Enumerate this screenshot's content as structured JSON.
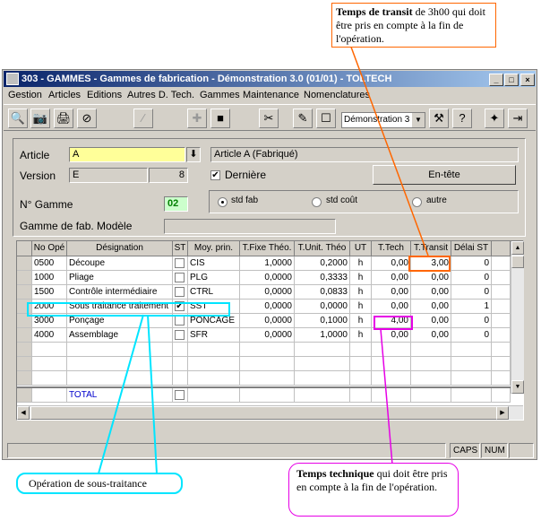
{
  "window": {
    "title": "303 - GAMMES - Gammes de fabrication - Démonstration 3.0 (01/01) - TOLTECH",
    "min": "_",
    "max": "□",
    "close": "×"
  },
  "menu": [
    "Gestion",
    "Articles",
    "Editions",
    "Autres D. Tech.",
    "Gammes",
    "Maintenance",
    "Nomenclatures"
  ],
  "toolbar": {
    "combo_value": "Démonstration 3"
  },
  "form": {
    "article_label": "Article",
    "article_value": "A",
    "article_desc": "Article A (Fabriqué)",
    "version_label": "Version",
    "version_value": "E",
    "version_num": "8",
    "derniere_label": "Dernière",
    "entete_label": "En-tête",
    "gamme_label": "N° Gamme",
    "gamme_value": "02",
    "radio_std_fab": "std fab",
    "radio_std_cout": "std coût",
    "radio_autre": "autre",
    "modele_label": "Gamme de fab. Modèle"
  },
  "columns": [
    "No Opé",
    "Désignation",
    "ST",
    "Moy. prin.",
    "T.Fixe Théo.",
    "T.Unit. Théo",
    "UT",
    "T.Tech",
    "T.Transit",
    "Délai ST"
  ],
  "rows": [
    {
      "no": "0500",
      "des": "Découpe",
      "st": "",
      "moy": "CIS",
      "tfixe": "1,0000",
      "tunit": "0,2000",
      "ut": "h",
      "ttech": "0,00",
      "ttransit": "3,00",
      "delai": "0"
    },
    {
      "no": "1000",
      "des": "Pliage",
      "st": "",
      "moy": "PLG",
      "tfixe": "0,0000",
      "tunit": "0,3333",
      "ut": "h",
      "ttech": "0,00",
      "ttransit": "0,00",
      "delai": "0"
    },
    {
      "no": "1500",
      "des": "Contrôle intermédiaire",
      "st": "",
      "moy": "CTRL",
      "tfixe": "0,0000",
      "tunit": "0,0833",
      "ut": "h",
      "ttech": "0,00",
      "ttransit": "0,00",
      "delai": "0"
    },
    {
      "no": "2000",
      "des": "Sous traitance traitement",
      "st": "✔",
      "moy": "SST",
      "tfixe": "0,0000",
      "tunit": "0,0000",
      "ut": "h",
      "ttech": "0,00",
      "ttransit": "0,00",
      "delai": "1"
    },
    {
      "no": "3000",
      "des": "Ponçage",
      "st": "",
      "moy": "PONCAGE",
      "tfixe": "0,0000",
      "tunit": "0,1000",
      "ut": "h",
      "ttech": "4,00",
      "ttransit": "0,00",
      "delai": "0"
    },
    {
      "no": "4000",
      "des": "Assemblage",
      "st": "",
      "moy": "SFR",
      "tfixe": "0,0000",
      "tunit": "1,0000",
      "ut": "h",
      "ttech": "0,00",
      "ttransit": "0,00",
      "delai": "0"
    }
  ],
  "total_label": "TOTAL",
  "status": {
    "caps": "CAPS",
    "num": "NUM"
  },
  "notes": {
    "transit_bold": "Temps de transit",
    "transit_rest": " de 3h00 qui doit être pris en compte à la fin de l'opération.",
    "soustraitance": "Opération de sous-traitance",
    "tech_bold": "Temps technique",
    "tech_rest": " qui doit être pris en compte à la fin de l'opération."
  },
  "colors": {
    "orange": "#ff6600",
    "cyan": "#00e5ff",
    "magenta": "#e600e6",
    "title": "#0a246a"
  }
}
